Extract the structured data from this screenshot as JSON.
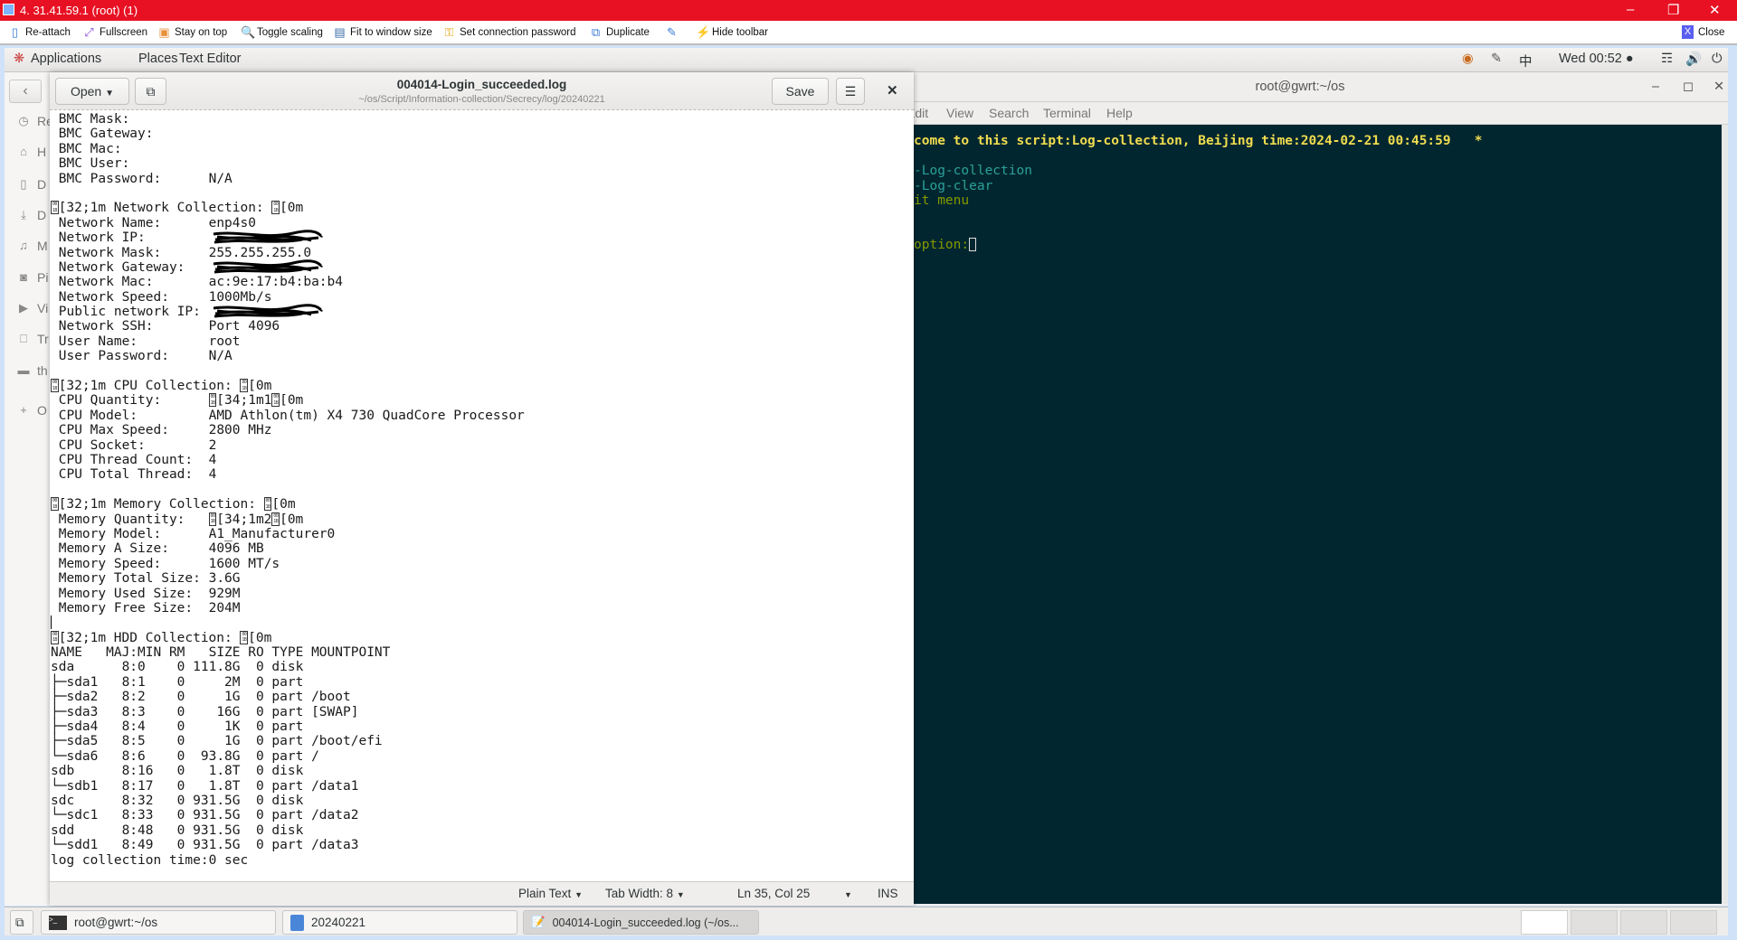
{
  "window": {
    "title": "4. 31.41.59.1 (root) (1)",
    "accent": "#e81123"
  },
  "toolbar": {
    "items": [
      {
        "label": "Re-attach",
        "icon": "re-attach-icon"
      },
      {
        "label": "Fullscreen",
        "icon": "fullscreen-icon"
      },
      {
        "label": "Stay on top",
        "icon": "stay-on-top-icon"
      },
      {
        "label": "Toggle scaling",
        "icon": "magnifier-icon"
      },
      {
        "label": "Fit to window size",
        "icon": "monitor-icon"
      },
      {
        "label": "Set connection password",
        "icon": "key-icon"
      },
      {
        "label": "Duplicate",
        "icon": "duplicate-icon"
      },
      {
        "label": "",
        "icon": "pencil-icon"
      },
      {
        "label": "Hide toolbar",
        "icon": "lightning-icon"
      }
    ],
    "close_label": "Close"
  },
  "panel": {
    "applications": "Applications",
    "places": "Places",
    "app_name": "Text Editor",
    "input_method": "中",
    "clock": "Wed 00:52 ●"
  },
  "sidebar": {
    "items": [
      {
        "label": "Re",
        "icon": "clock-icon"
      },
      {
        "label": "H",
        "icon": "home-icon"
      },
      {
        "label": "D",
        "icon": "document-icon"
      },
      {
        "label": "D",
        "icon": "download-icon"
      },
      {
        "label": "M",
        "icon": "music-icon"
      },
      {
        "label": "Pi",
        "icon": "camera-icon"
      },
      {
        "label": "Vi",
        "icon": "video-icon"
      },
      {
        "label": "Tr",
        "icon": "trash-icon"
      },
      {
        "label": "th",
        "icon": "drive-icon"
      },
      {
        "label": "O",
        "icon": "plus-icon"
      }
    ]
  },
  "editor": {
    "open_label": "Open",
    "title": "004014-Login_succeeded.log",
    "path": "~/os/Script/Information-collection/Secrecy/log/20240221",
    "save_label": "Save",
    "esc_hex": [
      "00",
      "1B"
    ],
    "lines": [
      " BMC Mask:",
      " BMC Gateway:",
      " BMC Mac:",
      " BMC User:",
      " BMC Password:      N/A",
      "",
      "\u001b[32;1m Network Collection: \u001b[0m",
      " Network Name:      enp4s0",
      {
        "text": " Network IP:        ",
        "redacted": true
      },
      " Network Mask:      255.255.255.0",
      {
        "text": " Network Gateway:   ",
        "redacted": true
      },
      " Network Mac:       ac:9e:17:b4:ba:b4",
      " Network Speed:     1000Mb/s",
      {
        "text": " Public network IP: ",
        "redacted": true
      },
      " Network SSH:       Port 4096",
      " User Name:         root",
      " User Password:     N/A",
      "",
      "\u001b[32;1m CPU Collection: \u001b[0m",
      " CPU Quantity:      \u001b[34;1m1\u001b[0m",
      " CPU Model:         AMD Athlon(tm) X4 730 QuadCore Processor",
      " CPU Max Speed:     2800 MHz",
      " CPU Socket:        2",
      " CPU Thread Count:  4",
      " CPU Total Thread:  4",
      "",
      "\u001b[32;1m Memory Collection: \u001b[0m",
      " Memory Quantity:   \u001b[34;1m2\u001b[0m",
      " Memory Model:      A1_Manufacturer0",
      " Memory A Size:     4096 MB",
      " Memory Speed:      1600 MT/s",
      " Memory Total Size: 3.6G",
      " Memory Used Size:  929M",
      " Memory Free Size:  204M",
      "",
      "\u001b[32;1m HDD Collection: \u001b[0m",
      "NAME   MAJ:MIN RM   SIZE RO TYPE MOUNTPOINT",
      "sda      8:0    0 111.8G  0 disk",
      "├─sda1   8:1    0     2M  0 part",
      "├─sda2   8:2    0     1G  0 part /boot",
      "├─sda3   8:3    0    16G  0 part [SWAP]",
      "├─sda4   8:4    0     1K  0 part",
      "├─sda5   8:5    0     1G  0 part /boot/efi",
      "└─sda6   8:6    0  93.8G  0 part /",
      "sdb      8:16   0   1.8T  0 disk",
      "└─sdb1   8:17   0   1.8T  0 part /data1",
      "sdc      8:32   0 931.5G  0 disk",
      "└─sdc1   8:33   0 931.5G  0 part /data2",
      "sdd      8:48   0 931.5G  0 disk",
      "└─sdd1   8:49   0 931.5G  0 part /data3",
      "log collection time:0 sec"
    ],
    "status": {
      "syntax": "Plain Text",
      "tab_width": "Tab Width: 8",
      "position": "Ln 35, Col 25",
      "mode": "INS"
    },
    "cursor": {
      "line": 35,
      "col": 25
    }
  },
  "terminal": {
    "title": "root@gwrt:~/os",
    "menu": [
      "Edit",
      "View",
      "Search",
      "Terminal",
      "Help"
    ],
    "lines": [
      {
        "text": "come to this script:Log-collection, Beijing time:2024-02-21 00:45:59   *",
        "color": "#f0dc4e",
        "bold": true
      },
      {
        "text": "-Log-collection",
        "color": "#2aa198"
      },
      {
        "text": "-Log-clear",
        "color": "#2aa198"
      },
      {
        "text": "it menu",
        "color": "#859900"
      },
      {
        "text": "option:",
        "color": "#859900"
      }
    ],
    "background": "#012630"
  },
  "taskbar": {
    "items": [
      {
        "label": "root@gwrt:~/os",
        "icon": "terminal-icon"
      },
      {
        "label": "20240221",
        "icon": "folder-icon"
      },
      {
        "label": "004014-Login_succeeded.log (~/os...",
        "icon": "text-editor-icon",
        "active": true
      }
    ]
  }
}
